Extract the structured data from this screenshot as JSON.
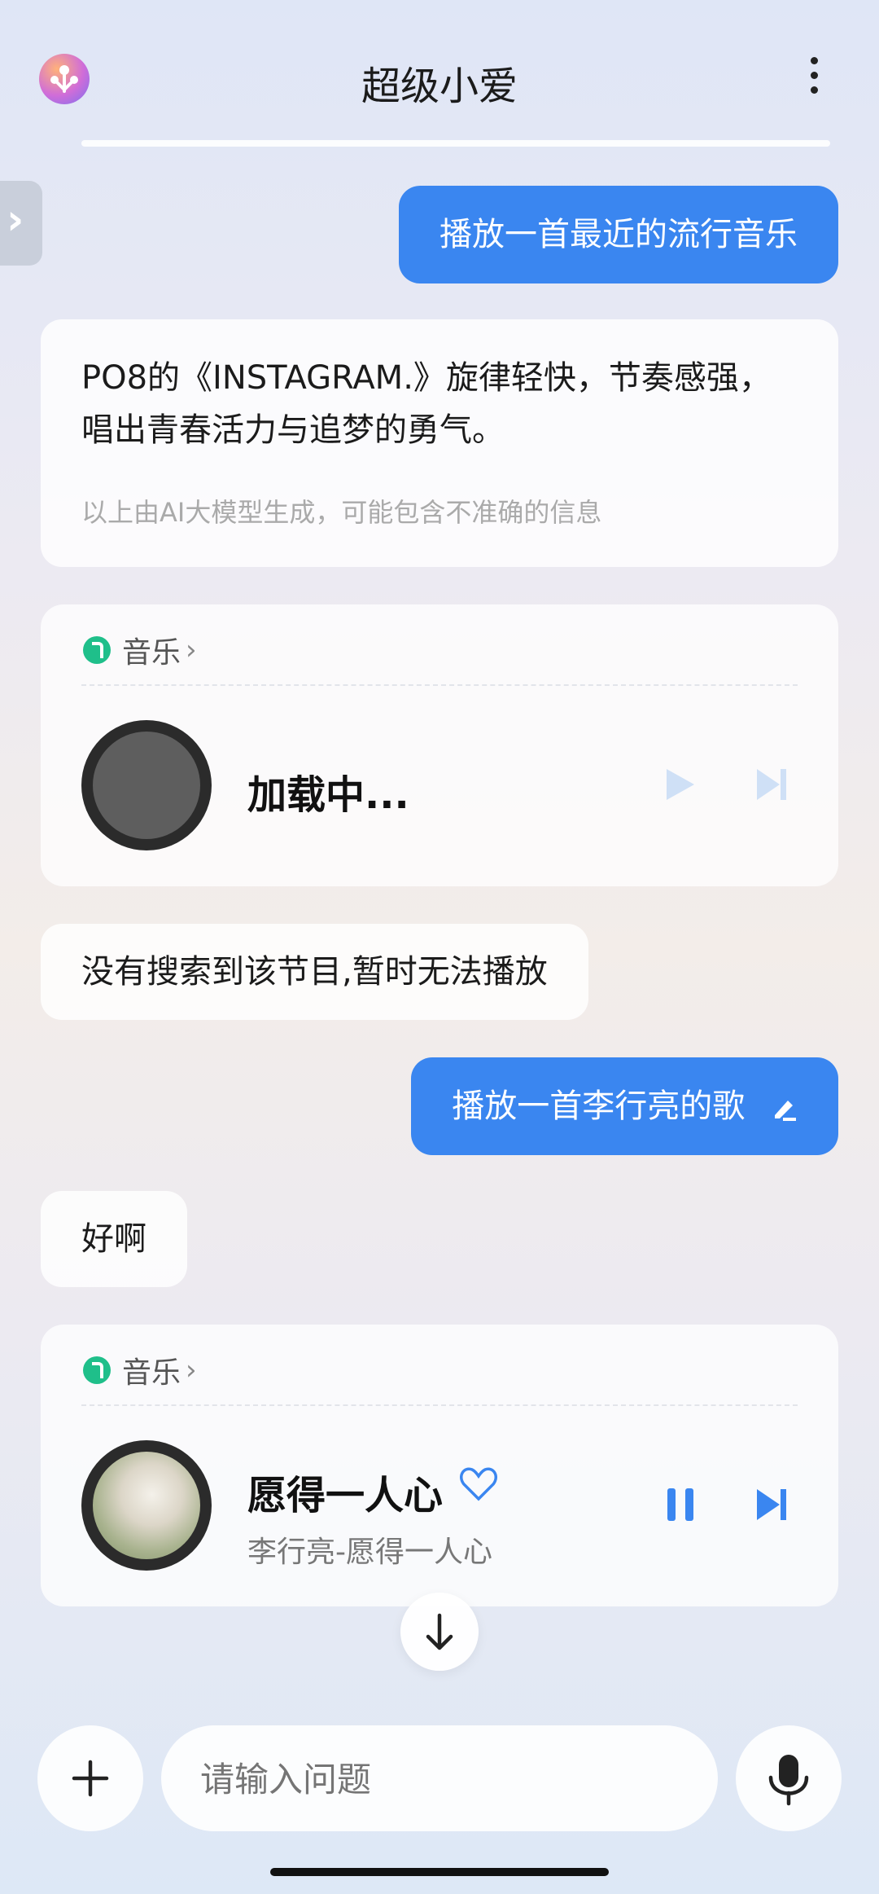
{
  "header": {
    "title": "超级小爱"
  },
  "messages": {
    "m1_user": "播放一首最近的流行音乐",
    "m2_ai_text": "PO8的《INSTAGRAM.》旋律轻快，节奏感强，唱出青春活力与追梦的勇气。",
    "m2_ai_note": "以上由AI大模型生成，可能包含不准确的信息",
    "m3_card_label": "音乐",
    "m3_card_status": "加载中...",
    "m4_ai": "没有搜索到该节目,暂时无法播放",
    "m5_user": "播放一首李行亮的歌",
    "m6_ai": "好啊",
    "m7_card_label": "音乐",
    "m7_song_title": "愿得一人心",
    "m7_song_sub": "李行亮-愿得一人心"
  },
  "input": {
    "placeholder": "请输入问题"
  },
  "colors": {
    "accent": "#3a86f0",
    "music_icon": "#1fbf8a"
  },
  "icons": [
    "app-logo-icon",
    "more-icon",
    "expand-icon",
    "music-app-icon",
    "play-icon",
    "next-icon",
    "heart-icon",
    "pause-icon",
    "edit-icon",
    "arrow-down-icon",
    "plus-icon",
    "mic-icon"
  ]
}
